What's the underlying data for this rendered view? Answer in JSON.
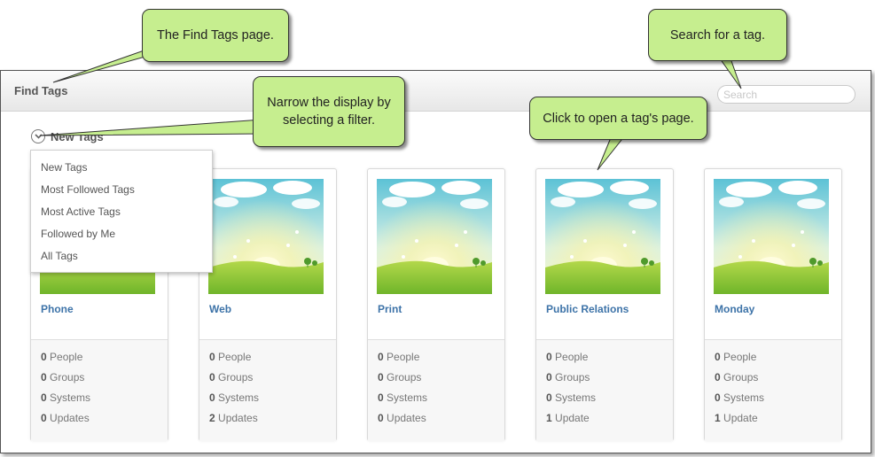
{
  "callouts": {
    "find_tags_page": "The Find Tags page.",
    "search": "Search for a tag.",
    "filter": "Narrow the display by selecting a filter.",
    "open_tag": "Click to open a tag's page."
  },
  "header": {
    "title": "Find Tags",
    "search_placeholder": "Search"
  },
  "filter": {
    "selected": "New Tags",
    "options": [
      "New Tags",
      "Most Followed Tags",
      "Most Active Tags",
      "Followed by Me",
      "All Tags"
    ]
  },
  "stat_labels": {
    "people": "People",
    "groups": "Groups",
    "systems": "Systems"
  },
  "tags": [
    {
      "name": "Phone",
      "people": "0",
      "groups": "0",
      "systems": "0",
      "updates": "0",
      "updates_label": "Updates"
    },
    {
      "name": "Web",
      "people": "0",
      "groups": "0",
      "systems": "0",
      "updates": "2",
      "updates_label": "Updates"
    },
    {
      "name": "Print",
      "people": "0",
      "groups": "0",
      "systems": "0",
      "updates": "0",
      "updates_label": "Updates"
    },
    {
      "name": "Public Relations",
      "people": "0",
      "groups": "0",
      "systems": "0",
      "updates": "1",
      "updates_label": "Update"
    },
    {
      "name": "Monday",
      "people": "0",
      "groups": "0",
      "systems": "0",
      "updates": "1",
      "updates_label": "Update"
    }
  ],
  "colors": {
    "callout_fill": "#c6ee8f",
    "tag_link": "#3d73a8"
  }
}
